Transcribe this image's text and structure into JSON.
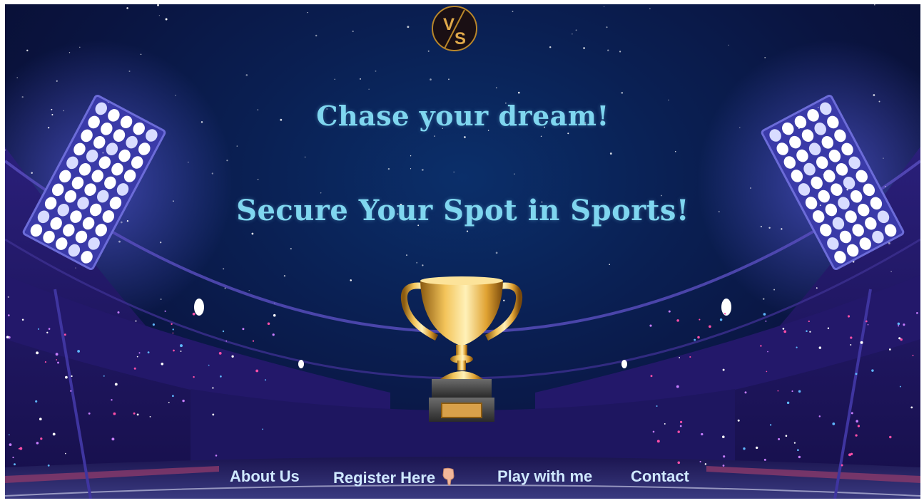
{
  "hero": {
    "line1": "Chase your dream!",
    "line2": "Secure Your Spot in Sports!"
  },
  "logo": {
    "text": "VS",
    "icon": "vs-logo-icon"
  },
  "nav": {
    "about": "About Us",
    "register": "Register Here",
    "play": "Play with me",
    "contact": "Contact"
  },
  "colors": {
    "headline": "#7fd6ef",
    "nav_text": "#cfe8ff",
    "sky": "#0a1f52",
    "trophy_gold": "#e7a52a"
  }
}
